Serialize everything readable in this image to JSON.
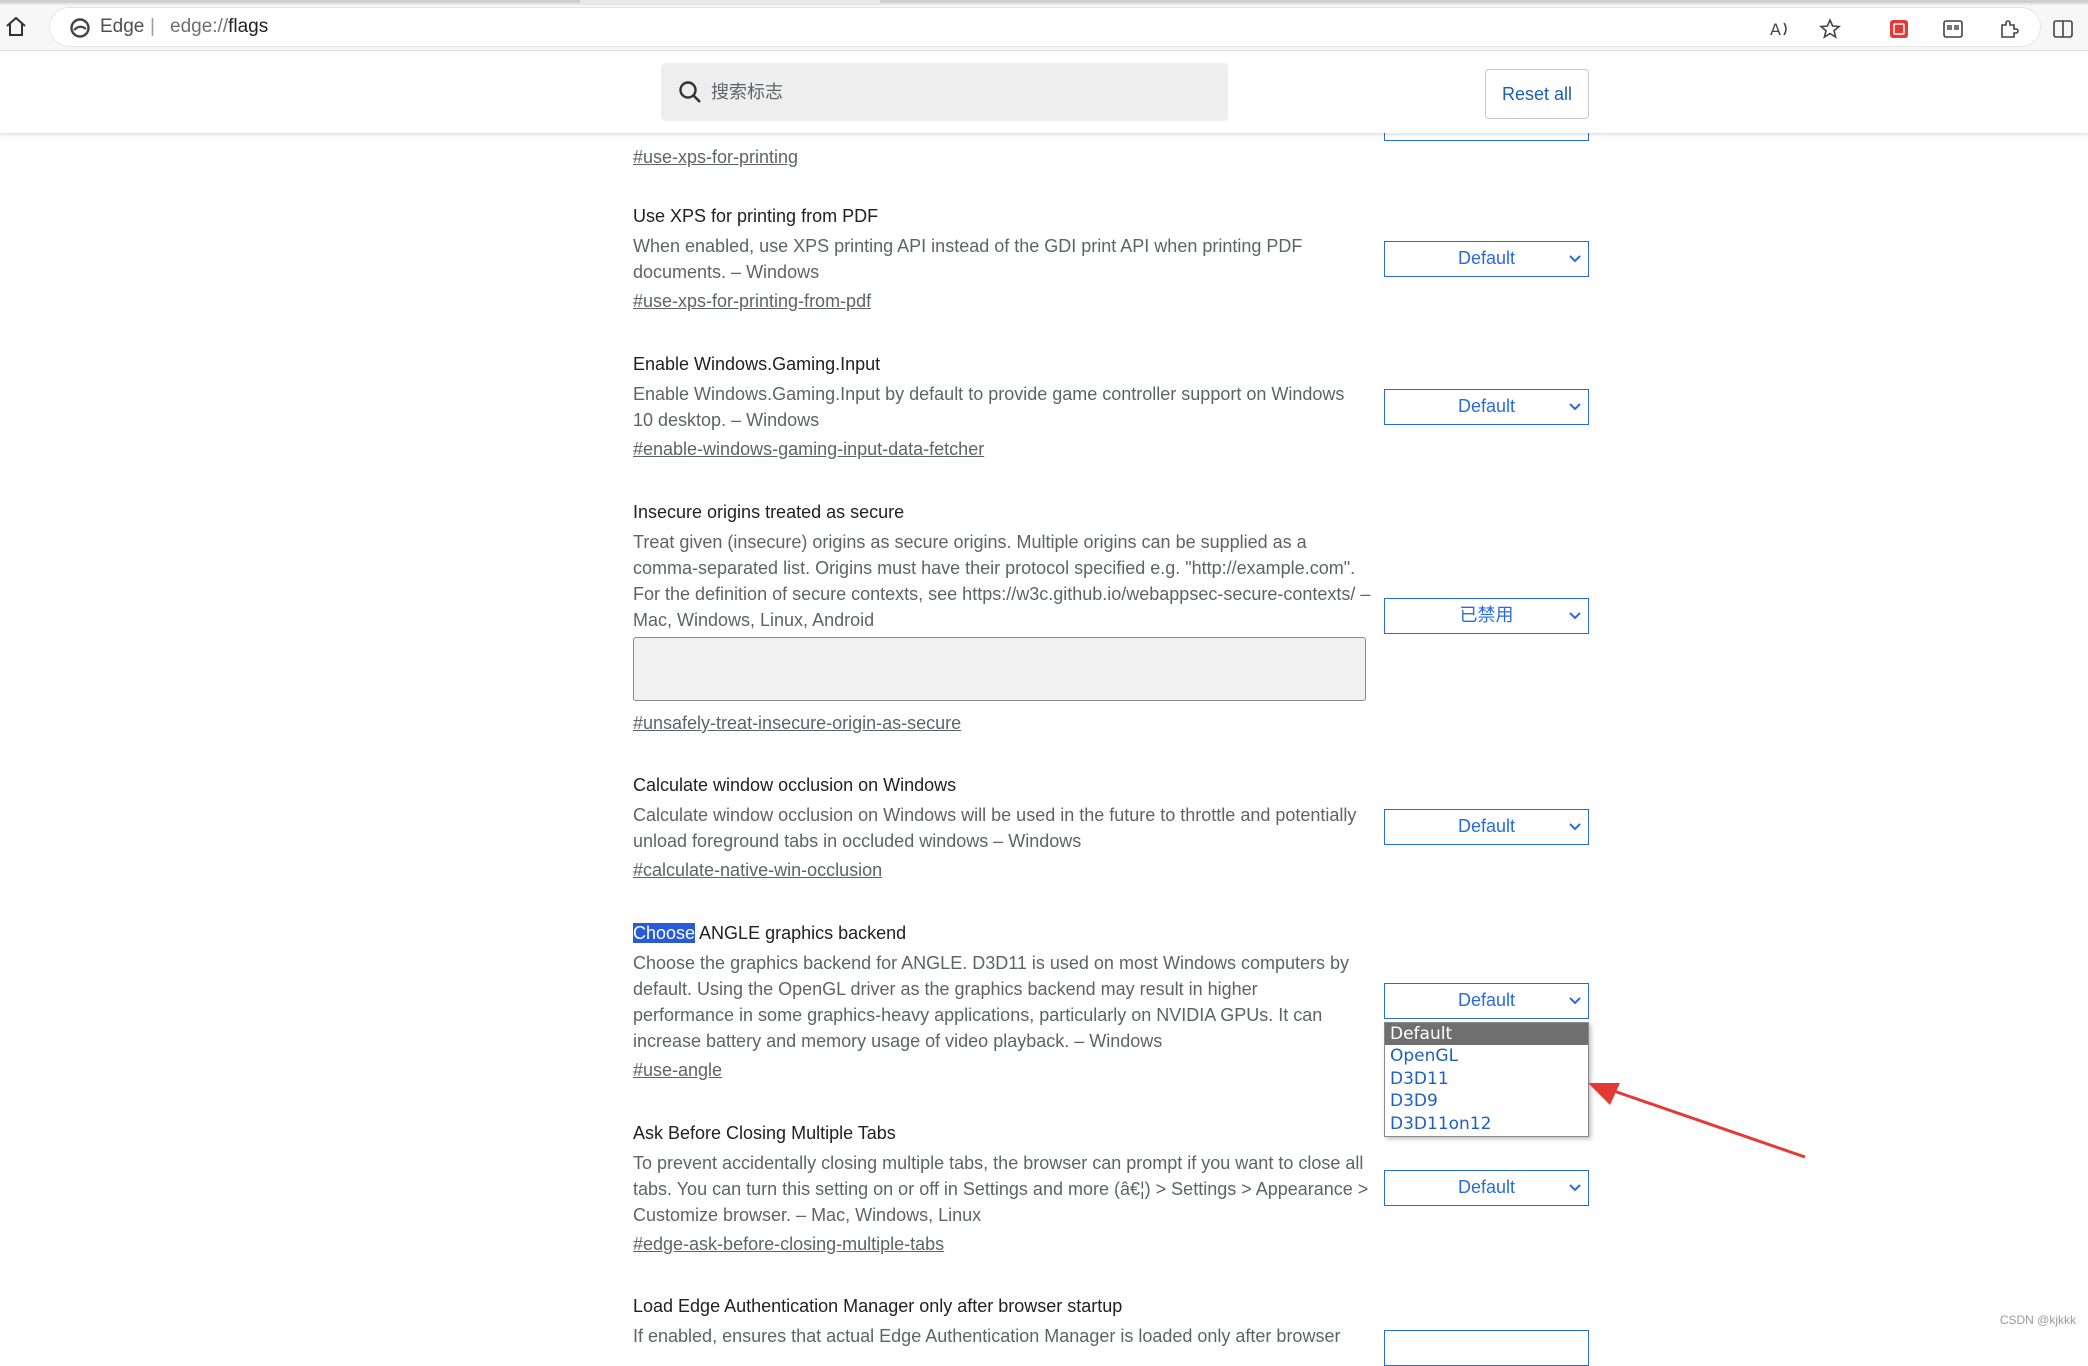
{
  "browser": {
    "brand": "Edge",
    "separator": "|",
    "url_scheme": "edge://",
    "url_path": "flags"
  },
  "header": {
    "search_placeholder": "搜索标志",
    "reset_label": "Reset all"
  },
  "experiments": [
    {
      "title": "",
      "description": "",
      "link": "#use-xps-for-printing",
      "select_value": ""
    },
    {
      "title": "Use XPS for printing from PDF",
      "description": "When enabled, use XPS printing API instead of the GDI print API when printing PDF documents. – Windows",
      "link": "#use-xps-for-printing-from-pdf",
      "select_value": "Default"
    },
    {
      "title": "Enable Windows.Gaming.Input",
      "description": "Enable Windows.Gaming.Input by default to provide game controller support on Windows 10 desktop. – Windows",
      "link": "#enable-windows-gaming-input-data-fetcher",
      "select_value": "Default"
    },
    {
      "title": "Insecure origins treated as secure",
      "description": "Treat given (insecure) origins as secure origins. Multiple origins can be supplied as a comma-separated list. Origins must have their protocol specified e.g. \"http://example.com\". For the definition of secure contexts, see https://w3c.github.io/webappsec-secure-contexts/ – Mac, Windows, Linux, Android",
      "link": "#unsafely-treat-insecure-origin-as-secure",
      "select_value": "已禁用"
    },
    {
      "title": "Calculate window occlusion on Windows",
      "description": "Calculate window occlusion on Windows will be used in the future to throttle and potentially unload foreground tabs in occluded windows – Windows",
      "link": "#calculate-native-win-occlusion",
      "select_value": "Default"
    },
    {
      "title_highlight": "Choose",
      "title_rest": " ANGLE graphics backend",
      "description": "Choose the graphics backend for ANGLE. D3D11 is used on most Windows computers by default. Using the OpenGL driver as the graphics backend may result in higher performance in some graphics-heavy applications, particularly on NVIDIA GPUs. It can increase battery and memory usage of video playback. – Windows",
      "link": "#use-angle",
      "select_value": "Default",
      "options": [
        "Default",
        "OpenGL",
        "D3D11",
        "D3D9",
        "D3D11on12"
      ]
    },
    {
      "title": "Ask Before Closing Multiple Tabs",
      "description": "To prevent accidentally closing multiple tabs, the browser can prompt if you want to close all tabs. You can turn this setting on or off in Settings and more (â€¦) > Settings > Appearance > Customize browser. – Mac, Windows, Linux",
      "link": "#edge-ask-before-closing-multiple-tabs",
      "select_value": "Default"
    },
    {
      "title": "Load Edge Authentication Manager only after browser startup",
      "description": "If enabled, ensures that actual Edge Authentication Manager is loaded only after browser",
      "select_value": ""
    }
  ],
  "watermark": "CSDN @kjkkk",
  "colors": {
    "accent": "#2a6adf",
    "highlight": "#2a5bd7",
    "arrow": "#e53935",
    "popup_selected": "#6f6f6f"
  }
}
